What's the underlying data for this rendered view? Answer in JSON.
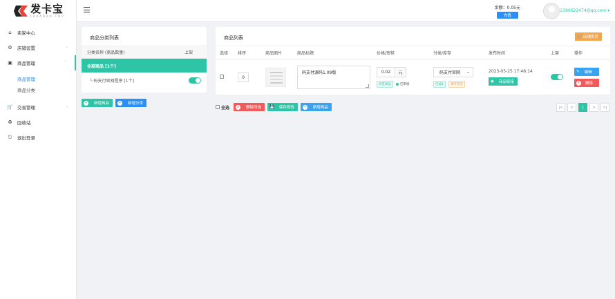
{
  "brand": {
    "name": "发卡宝",
    "sub": "FAKABAO.TOP"
  },
  "sidebar": {
    "items": [
      {
        "label": "卖家中心",
        "icon": "home-icon"
      },
      {
        "label": "店铺设置",
        "icon": "gear-icon"
      },
      {
        "label": "商品管理",
        "icon": "bag-icon"
      },
      {
        "label": "交易管理",
        "icon": "cart-icon"
      },
      {
        "label": "回收站",
        "icon": "recycle-icon"
      },
      {
        "label": "退出登录",
        "icon": "logout-icon"
      }
    ],
    "sub_items": [
      {
        "label": "商品管理"
      },
      {
        "label": "商品分类"
      }
    ]
  },
  "header": {
    "balance_label": "余额：0.05元",
    "recharge_label": "充值",
    "user_email": "2386622474@qq.com"
  },
  "category_panel": {
    "title": "商品分类列表",
    "col_name": "分类名称 (商品数量)",
    "col_on": "上架",
    "all_label": "全部商品 [1个]",
    "rows": [
      {
        "name": "└ 码支付官网程序 [1个]"
      }
    ],
    "add_product_label": "新增商品",
    "add_category_label": "新增分类"
  },
  "list_panel": {
    "title": "商品列表",
    "shop_home_label": "店铺首页",
    "columns": [
      "选择",
      "排序",
      "商品图片",
      "商品标题",
      "价格/审核",
      "分类/库存",
      "发布时间",
      "上架",
      "操作"
    ],
    "rows": [
      {
        "sort": "0",
        "title": "码支付源码1.09版",
        "price": "0.02",
        "unit": "元",
        "tag_normal": "码支商品",
        "review": "已审核",
        "category": "码支付官网",
        "stock_tag1": "已加1",
        "stock_tag2": "库存充足",
        "time": "2023-05-25 17:48:14",
        "link_label": "商品链接",
        "edit_label": "编辑",
        "delete_label": "删除"
      }
    ]
  },
  "bulk": {
    "select_all": "全选",
    "delete_selected": "删除所选",
    "save_changes": "保存修改",
    "add_product": "新增商品"
  },
  "pager": {
    "first": "|<",
    "prev": "<",
    "current": "1",
    "next": ">",
    "last": ">|"
  },
  "colors": {
    "teal": "#2ec4a6",
    "blue": "#2a8ff7",
    "red": "#f05a5a",
    "orange": "#f3a64b"
  }
}
